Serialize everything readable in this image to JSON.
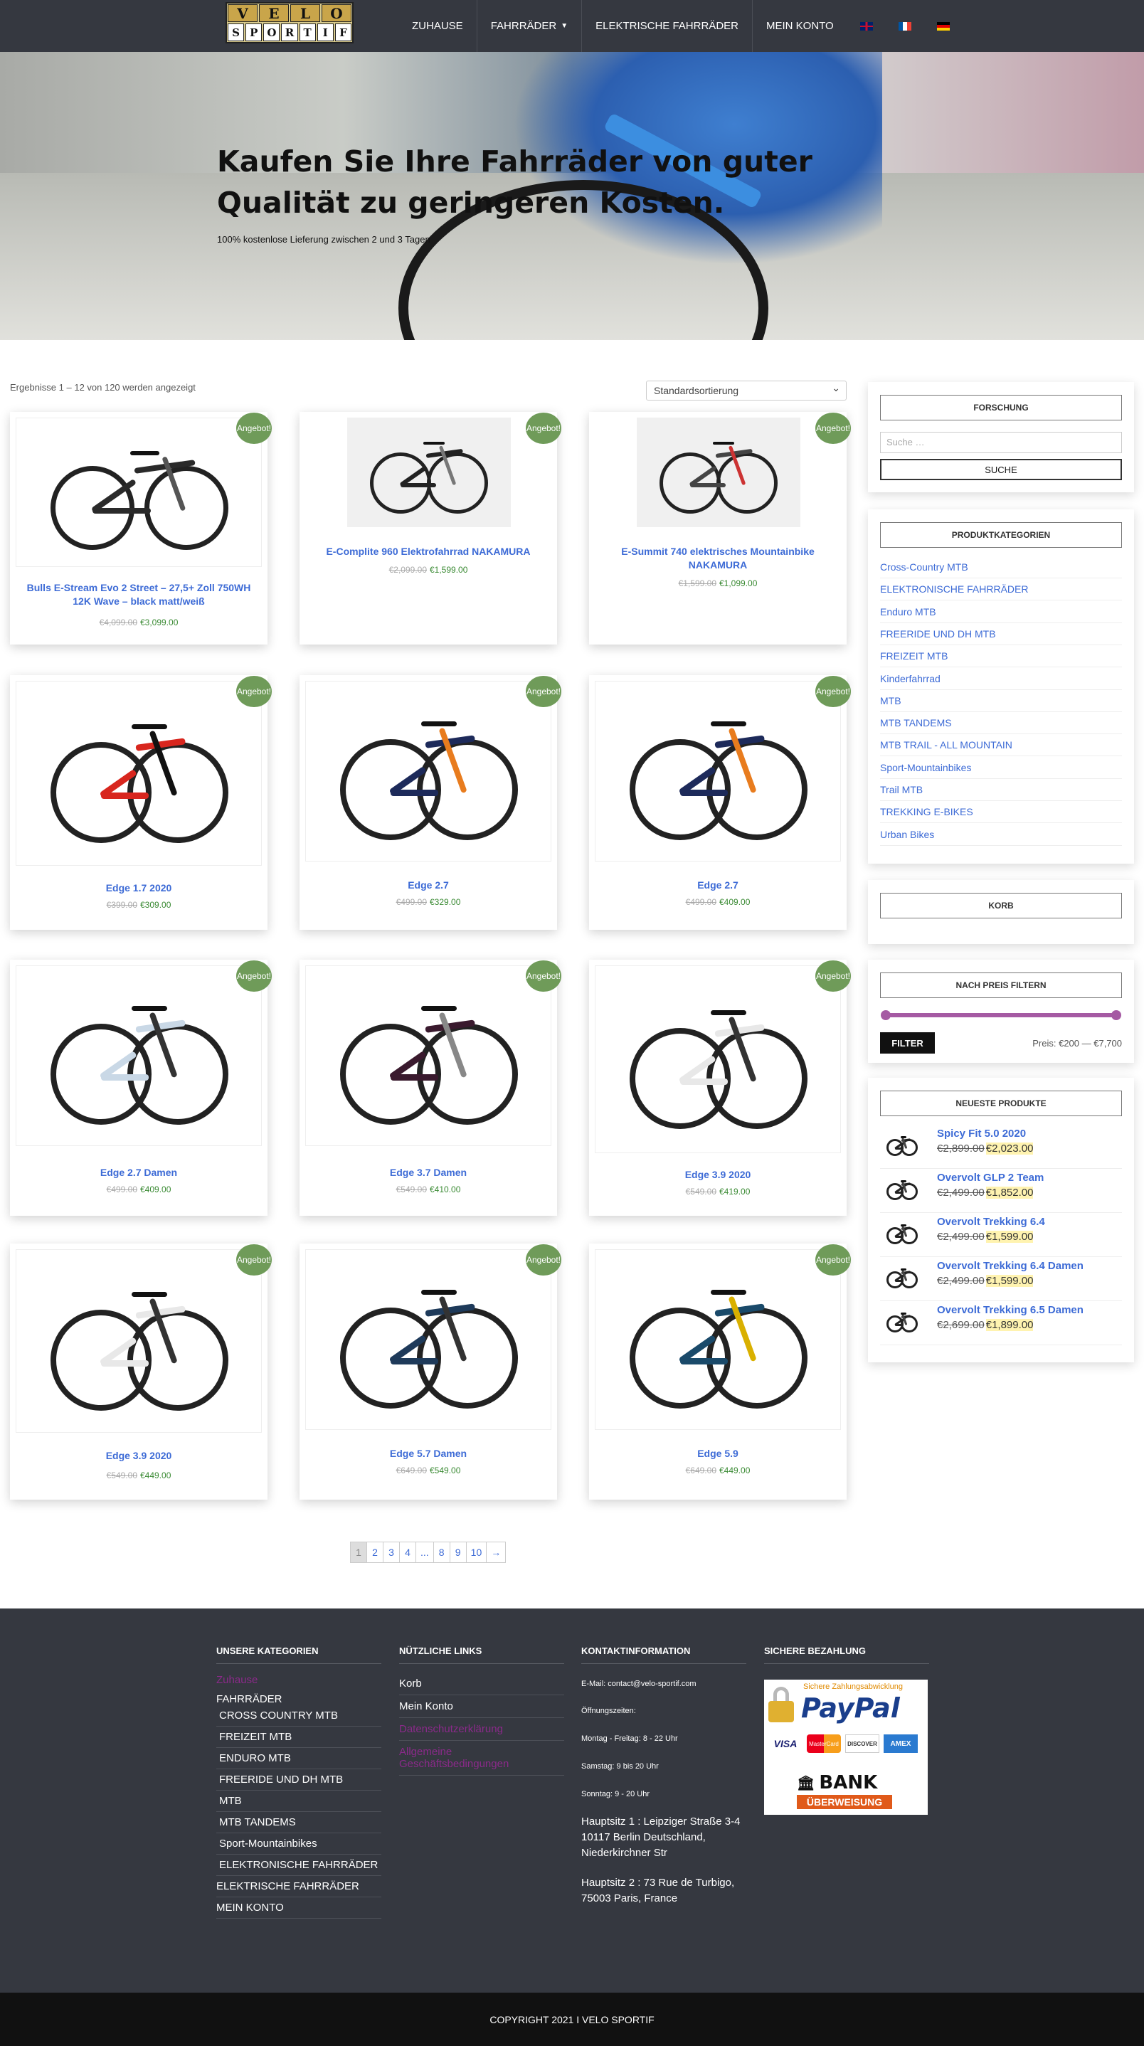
{
  "nav": {
    "logo_top": [
      "V",
      "E",
      "L",
      "O"
    ],
    "logo_bottom": [
      "S",
      "P",
      "O",
      "R",
      "T",
      "I",
      "F"
    ],
    "items": [
      "ZUHAUSE",
      "FAHRRÄDER",
      "ELEKTRISCHE FAHRRÄDER",
      "MEIN KONTO"
    ],
    "flags": [
      "flag-uk-icon",
      "flag-fr-icon",
      "flag-de-icon"
    ]
  },
  "hero": {
    "heading": "Kaufen Sie Ihre Fahrräder von guter Qualität zu geringeren Kosten.",
    "subtext": "100% kostenlose Lieferung zwischen 2 und 3 Tagen"
  },
  "shop": {
    "results": "Ergebnisse 1 – 12 von 120 werden angezeigt",
    "sort": "Standardsortierung",
    "badge": "Angebot!",
    "products": [
      {
        "title": "Bulls E-Stream Evo 2 Street – 27,5+ Zoll 750WH 12K Wave – black matt/weiß",
        "old": "€4,099.00",
        "new": "€3,099.00",
        "color": "#2a2a2a",
        "accent": "#555"
      },
      {
        "title": "E-Complite 960 Elektrofahrrad NAKAMURA",
        "old": "€2,099.00",
        "new": "€1,599.00",
        "color": "#222",
        "accent": "#777"
      },
      {
        "title": "E-Summit 740 elektrisches Mountainbike NAKAMURA",
        "old": "€1,599.00",
        "new": "€1,099.00",
        "color": "#444",
        "accent": "#c33"
      },
      {
        "title": "Edge 1.7 2020",
        "old": "€399.00",
        "new": "€309.00",
        "color": "#d8261e",
        "accent": "#111"
      },
      {
        "title": "Edge 2.7",
        "old": "€499.00",
        "new": "€329.00",
        "color": "#1d2a5a",
        "accent": "#e87c1e"
      },
      {
        "title": "Edge 2.7",
        "old": "€499.00",
        "new": "€409.00",
        "color": "#1d2a5a",
        "accent": "#e87c1e"
      },
      {
        "title": "Edge 2.7 Damen",
        "old": "€499.00",
        "new": "€409.00",
        "color": "#c9d8e6",
        "accent": "#333"
      },
      {
        "title": "Edge 3.7 Damen",
        "old": "€549.00",
        "new": "€410.00",
        "color": "#3a1a2e",
        "accent": "#888"
      },
      {
        "title": "Edge 3.9 2020",
        "old": "€549.00",
        "new": "€419.00",
        "color": "#e8e8e8",
        "accent": "#333"
      },
      {
        "title": "Edge 3.9 2020",
        "old": "€549.00",
        "new": "€449.00",
        "color": "#e8e8e8",
        "accent": "#333"
      },
      {
        "title": "Edge 5.7 Damen",
        "old": "€649.00",
        "new": "€549.00",
        "color": "#1e3a5a",
        "accent": "#333"
      },
      {
        "title": "Edge 5.9",
        "old": "€649.00",
        "new": "€449.00",
        "color": "#1a4a6a",
        "accent": "#d9b000"
      }
    ],
    "pagination": [
      "1",
      "2",
      "3",
      "4",
      "...",
      "8",
      "9",
      "10",
      "→"
    ]
  },
  "sidebar": {
    "search_title": "FORSCHUNG",
    "search_placeholder": "Suche …",
    "search_button": "SUCHE",
    "categories_title": "PRODUKTKATEGORIEN",
    "categories": [
      "Cross-Country MTB",
      "ELEKTRONISCHE FAHRRÄDER",
      "Enduro MTB",
      "FREERIDE UND DH MTB",
      "FREIZEIT MTB",
      "Kinderfahrrad",
      "MTB",
      "MTB TANDEMS",
      "MTB TRAIL - ALL MOUNTAIN",
      "Sport-Mountainbikes",
      "Trail MTB",
      "TREKKING E-BIKES",
      "Urban Bikes"
    ],
    "cart_title": "KORB",
    "price_title": "NACH PREIS FILTERN",
    "filter_button": "FILTER",
    "price_range": "Preis: €200 — €7,700",
    "newest_title": "NEUESTE PRODUKTE",
    "newest": [
      {
        "title": "Spicy Fit 5.0 2020",
        "old": "€2,899.00",
        "new": "€2,023.00"
      },
      {
        "title": "Overvolt GLP 2 Team",
        "old": "€2,499.00",
        "new": "€1,852.00"
      },
      {
        "title": "Overvolt Trekking 6.4",
        "old": "€2,499.00",
        "new": "€1,599.00"
      },
      {
        "title": "Overvolt Trekking 6.4 Damen",
        "old": "€2,499.00",
        "new": "€1,599.00"
      },
      {
        "title": "Overvolt Trekking 6.5 Damen",
        "old": "€2,699.00",
        "new": "€1,899.00"
      }
    ]
  },
  "footer": {
    "col1_title": "UNSERE KATEGORIEN",
    "col1_first": "Zuhause",
    "col1_parent": "FAHRRÄDER",
    "col1_sub": [
      "CROSS COUNTRY MTB",
      "FREIZEIT MTB",
      "ENDURO MTB",
      "FREERIDE UND DH MTB",
      "MTB",
      "MTB TANDEMS",
      "Sport-Mountainbikes",
      "ELEKTRONISCHE FAHRRÄDER"
    ],
    "col1_after": [
      "ELEKTRISCHE FAHRRÄDER",
      "MEIN KONTO"
    ],
    "col2_title": "NÜTZLICHE LINKS",
    "col2_links": [
      "Korb",
      "Mein Konto",
      "Datenschutzerklärung",
      "Allgemeine Geschäftsbedingungen"
    ],
    "col3_title": "KONTAKTINFORMATION",
    "email": "E-Mail: contact@velo-sportif.com",
    "hours_label": "Öffnungszeiten:",
    "hours": [
      "Montag - Freitag: 8 - 22 Uhr",
      "Samstag: 9 bis 20 Uhr",
      "Sonntag: 9 - 20 Uhr"
    ],
    "address1": "Hauptsitz 1 : Leipziger Straße 3-4 10117 Berlin Deutschland, Niederkirchner Str",
    "address2": "Hauptsitz 2 : 73 Rue de Turbigo, 75003 Paris, France",
    "col4_title": "SICHERE BEZAHLUNG",
    "pay_top": "Sichere Zahlungsabwicklung",
    "pay_brand": "PayPal",
    "cards": [
      "VISA",
      "MasterCard",
      "DISCOVER",
      "AMEX"
    ],
    "bank": "BANK",
    "bank_sub": "ÜBERWEISUNG",
    "copyright": "COPYRIGHT 2021 I VELO SPORTIF"
  }
}
